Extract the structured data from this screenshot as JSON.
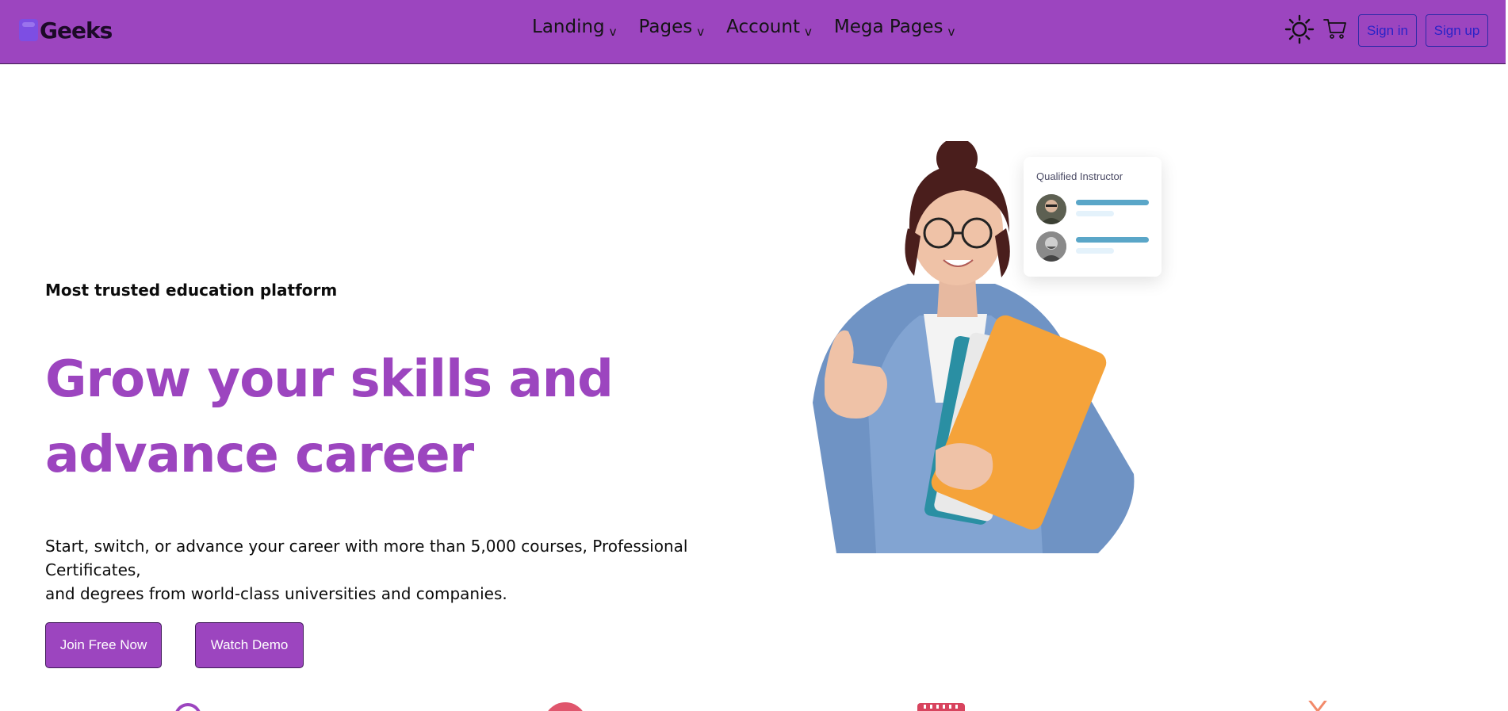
{
  "brand": {
    "name": "Geeks"
  },
  "nav": {
    "items": [
      {
        "label": "Landing",
        "caret": "v"
      },
      {
        "label": "Pages",
        "caret": "v"
      },
      {
        "label": "Account",
        "caret": "v"
      },
      {
        "label": "Mega Pages",
        "caret": "v"
      }
    ],
    "signin_label": "Sign in",
    "signup_label": "Sign up"
  },
  "hero": {
    "eyebrow": "Most trusted education platform",
    "headline_line1": "Grow your skills and",
    "headline_line2": "advance career",
    "description_line1": "Start, switch, or advance your career with more than 5,000 courses, Professional",
    "description_line2": "Certificates,",
    "description_line3": "and degrees from world-class universities and companies.",
    "cta_primary": "Join Free Now",
    "cta_secondary": "Watch Demo"
  },
  "instructor_card": {
    "title": "Qualified Instructor"
  },
  "icons": {
    "logo": "geeks-logo-icon",
    "theme": "sun-icon",
    "cart": "cart-icon",
    "features": [
      "target-icon",
      "circle-badge-icon",
      "calendar-icon",
      "spark-icon"
    ]
  },
  "colors": {
    "brand_purple": "#9c45bf",
    "nav_border": "#3e1c4e",
    "link_blue": "#2a23c7",
    "card_bar": "#5aa6c8",
    "card_bar_light": "#e4f2fb"
  }
}
